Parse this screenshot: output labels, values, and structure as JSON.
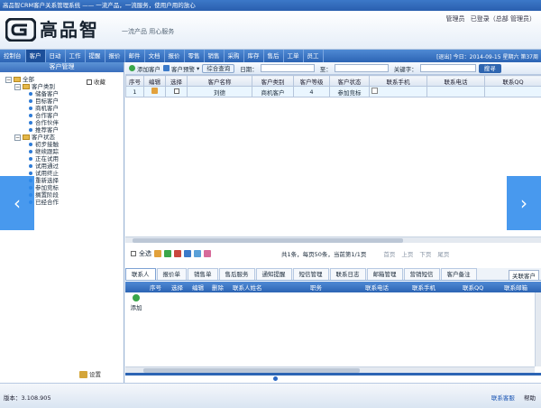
{
  "window": {
    "title": "高品智CRM客户关系管理系统 —— 一流产品，一流服务，使用户用的放心"
  },
  "header": {
    "brand": "高品智",
    "slogan": "一流产品 用心服务",
    "user_role": "管理员",
    "login_status": "已登录（总部 管理员）"
  },
  "nav": {
    "items": [
      "控制台",
      "客户",
      "日动",
      "工作",
      "提醒",
      "报价",
      "邮件",
      "文档",
      "报价",
      "零售",
      "销售",
      "采购",
      "库存",
      "售后",
      "工单",
      "员工"
    ],
    "right_text": "[退出] 今日：2014-09-15 星期六 第37周"
  },
  "sidebar": {
    "title": "客户管理",
    "favorites_label": "收藏",
    "tree_root": "全部",
    "groups": [
      {
        "label": "客户类别",
        "items": [
          "储备客户",
          "目标客户",
          "商机客户",
          "合作客户",
          "合作伙伴",
          "推荐客户"
        ]
      },
      {
        "label": "客户状态",
        "items": [
          "初步接触",
          "继续跟踪",
          "正在试用",
          "试用通过",
          "试用终止",
          "重新选择",
          "参加竞标",
          "搁置阶段",
          "已经合作"
        ]
      }
    ],
    "settings_label": "设置"
  },
  "toolbar": {
    "add_customer": "添加客户",
    "customer_alarm": "客户预警",
    "combined_query": "综合查询",
    "date_label": "日期：",
    "to_label": "至：",
    "keyword_label": "关键字：",
    "search_button": "搜寻"
  },
  "grid": {
    "columns": [
      "序号",
      "编辑",
      "选择",
      "客户名称",
      "客户类别",
      "客户等级",
      "客户状态",
      "联系手机",
      "联系电话",
      "联系QQ"
    ],
    "rows": [
      {
        "index": "1",
        "name": "刘德",
        "category": "商机客户",
        "level": "4",
        "status": "参加竞标"
      }
    ]
  },
  "pager": {
    "select_all": "全选",
    "info": "共1条，每页50条，当前第1/1页",
    "first": "首页",
    "prev": "上页",
    "next": "下页",
    "last": "尾页"
  },
  "subtabs": {
    "items": [
      "联系人",
      "报价单",
      "销售单",
      "售后服务",
      "通知提醒",
      "短信管理",
      "联系日志",
      "邮箱管理",
      "营销短信",
      "客户备注"
    ],
    "extra": "关联客户"
  },
  "subgrid": {
    "add_label": "添加",
    "columns": [
      "序号",
      "选择",
      "编辑",
      "删除",
      "联系人姓名",
      "职务",
      "联系电话",
      "联系手机",
      "联系QQ",
      "联系邮箱"
    ]
  },
  "status_bar": {
    "version": "版本：3.108.905",
    "contact_service": "联系客服",
    "help": "帮助"
  }
}
